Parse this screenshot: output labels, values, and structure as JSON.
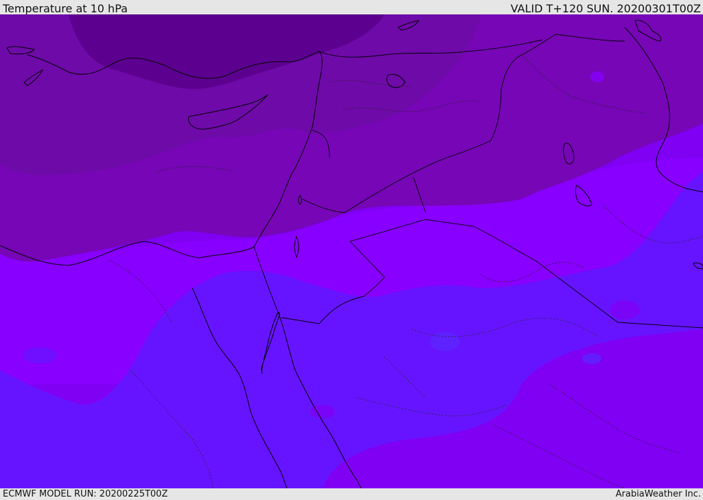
{
  "header": {
    "title": "Temperature at 10 hPa",
    "valid_time": "VALID T+120 SUN. 20200301T00Z"
  },
  "footer": {
    "model_run": "ECMWF MODEL RUN: 20200225T00Z",
    "credit": "ArabiaWeather Inc."
  },
  "map": {
    "parameter": "temperature",
    "pressure_level": "10 hPa",
    "shading_colors": [
      "#5c0090",
      "#6e0aa8",
      "#7606b6",
      "#8000f4",
      "#8600ff",
      "#6614ff"
    ],
    "coastline_color": "#000000",
    "border_style": "dotted"
  }
}
